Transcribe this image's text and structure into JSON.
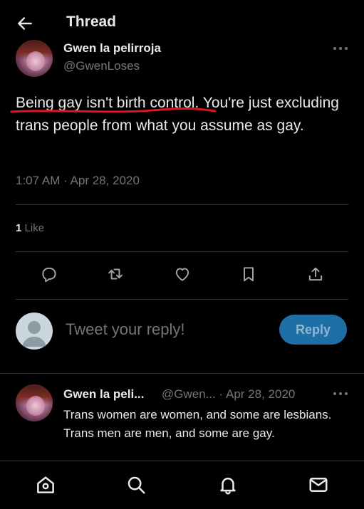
{
  "header": {
    "title": "Thread"
  },
  "tweet": {
    "author_name": "Gwen la pelirroja",
    "author_handle": "@GwenLoses",
    "text_underlined": "Being gay isn't birth control",
    "text_rest": ". You're just excluding trans people from what you assume as gay.",
    "timestamp": "1:07 AM · Apr 28, 2020",
    "like_count": "1",
    "like_label": "Like"
  },
  "composer": {
    "placeholder": "Tweet your reply!",
    "reply_button": "Reply"
  },
  "reply": {
    "author_name": "Gwen la peli...",
    "meta": "@Gwen... · Apr 28, 2020",
    "text": "Trans women are women, and some are lesbians. Trans men are men, and some are gay."
  },
  "icons": {
    "back": "arrow-left-icon",
    "more": "more-horizontal-icon",
    "actions": [
      "reply-icon",
      "retweet-icon",
      "like-icon",
      "bookmark-icon",
      "share-icon"
    ],
    "nav": [
      "home-icon",
      "search-icon",
      "notifications-icon",
      "messages-icon"
    ]
  },
  "colors": {
    "background": "#000000",
    "text": "#e7e9ea",
    "secondary": "#71767b",
    "divider": "#2f3336",
    "reply_button_bg": "#1d6fa5",
    "annotation": "#e0141e"
  }
}
